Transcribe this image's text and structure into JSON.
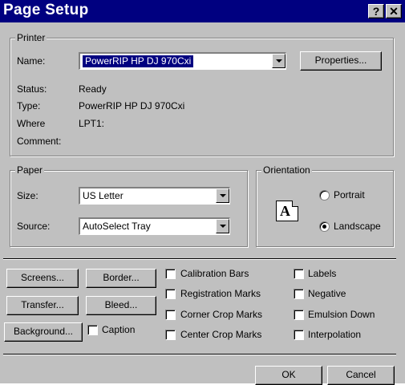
{
  "window": {
    "title": "Page Setup",
    "help_label": "?",
    "close_label": "✕"
  },
  "printer": {
    "group_label": "Printer",
    "name_label": "Name:",
    "name_value": "PowerRIP HP DJ 970Cxi",
    "properties_label": "Properties...",
    "status_label": "Status:",
    "status_value": "Ready",
    "type_label": "Type:",
    "type_value": "PowerRIP HP DJ 970Cxi",
    "where_label": "Where",
    "where_value": "LPT1:",
    "comment_label": "Comment:"
  },
  "paper": {
    "group_label": "Paper",
    "size_label": "Size:",
    "size_value": "US Letter",
    "source_label": "Source:",
    "source_value": "AutoSelect Tray"
  },
  "orientation": {
    "group_label": "Orientation",
    "icon_letter": "A",
    "portrait_label": "Portrait",
    "landscape_label": "Landscape",
    "selected": "Landscape"
  },
  "buttons": {
    "screens": "Screens...",
    "border": "Border...",
    "transfer": "Transfer...",
    "bleed": "Bleed...",
    "background": "Background...",
    "ok": "OK",
    "cancel": "Cancel"
  },
  "options": {
    "caption": "Caption",
    "calibration_bars": "Calibration Bars",
    "registration_marks": "Registration Marks",
    "corner_crop_marks": "Corner Crop Marks",
    "center_crop_marks": "Center Crop Marks",
    "labels": "Labels",
    "negative": "Negative",
    "emulsion_down": "Emulsion Down",
    "interpolation": "Interpolation"
  }
}
